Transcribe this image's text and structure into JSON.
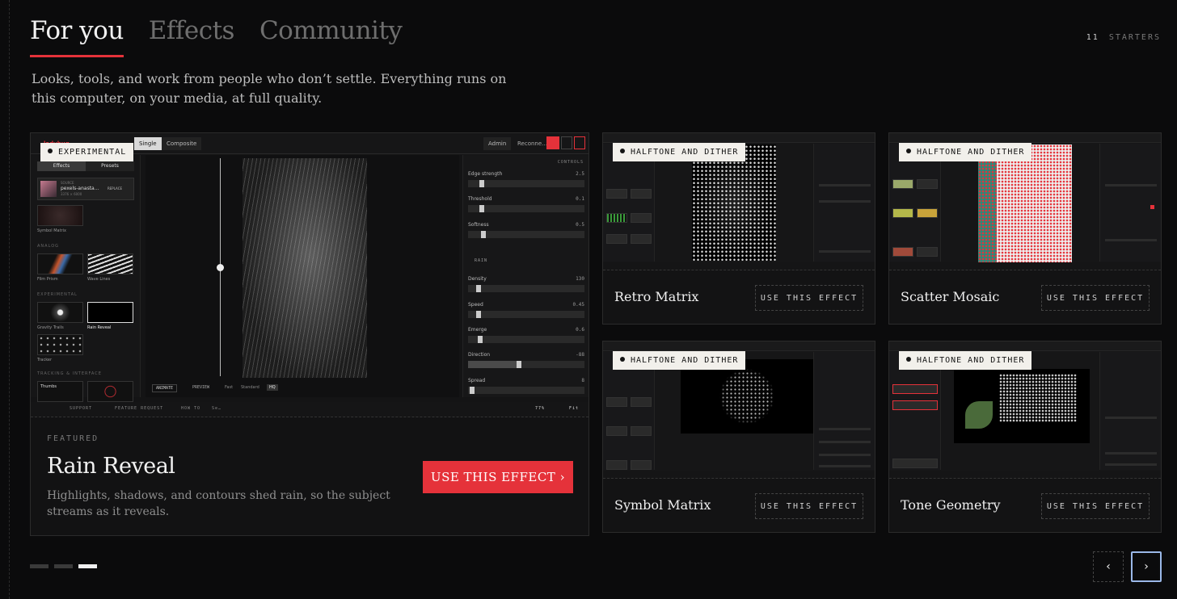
{
  "tabs": [
    "For you",
    "Effects",
    "Community"
  ],
  "starters": {
    "count": "11",
    "label": "STARTERS"
  },
  "intro": "Looks, tools, and work from people who don’t settle. Everything runs on this computer, on your media, at full quality.",
  "featured": {
    "badge": "EXPERIMENTAL",
    "kicker": "FEATURED",
    "title": "Rain Reveal",
    "description": "Highlights, shadows, and contours shed rain, so the subject streams as it reveals.",
    "cta": "USE THIS EFFECT ›",
    "app": {
      "logo": "ladybug",
      "modes": [
        "Single",
        "Composite"
      ],
      "user": "Admin",
      "status": "Reconne…",
      "left_tabs": [
        "Effects",
        "Presets"
      ],
      "source_label": "SOURCE",
      "source_name": "pexels-anasta…",
      "source_dims": "3376 × 6000",
      "replace": "REPLACE",
      "symbol_matrix": "Symbol Matrix",
      "section_analog": "ANALOG",
      "analog": [
        "Film Prism",
        "Wave Lines"
      ],
      "section_experimental": "EXPERIMENTAL",
      "experimental": [
        "Gravity Trails",
        "Rain Reveal"
      ],
      "tracker": "Tracker",
      "section_tracking": "TRACKING & INTERFACE",
      "thumbs": "Thumbs",
      "controls_title": "CONTROLS",
      "controls": [
        {
          "name": "Edge strength",
          "value": "2.5"
        },
        {
          "name": "Threshold",
          "value": "0.1"
        },
        {
          "name": "Softness",
          "value": "0.5"
        }
      ],
      "rain_section": "RAIN",
      "rain_controls": [
        {
          "name": "Density",
          "value": "130"
        },
        {
          "name": "Speed",
          "value": "0.45"
        },
        {
          "name": "Emerge",
          "value": "0.6"
        },
        {
          "name": "Direction",
          "value": "-88"
        },
        {
          "name": "Spread",
          "value": "8"
        }
      ],
      "animate": "ANIMATE",
      "preview": "PREVIEW",
      "quality": [
        "Fast",
        "Standard",
        "HQ"
      ],
      "bottom": [
        "SUPPORT",
        "FEATURE REQUEST",
        "HOW TO"
      ],
      "search_placeholder": "Se…",
      "zoom": "77%",
      "fit": "Fit"
    }
  },
  "cards": [
    {
      "title": "Retro Matrix",
      "badge": "HALFTONE AND DITHER",
      "cta": "USE THIS EFFECT"
    },
    {
      "title": "Scatter Mosaic",
      "badge": "HALFTONE AND DITHER",
      "cta": "USE THIS EFFECT"
    },
    {
      "title": "Symbol Matrix",
      "badge": "HALFTONE AND DITHER",
      "cta": "USE THIS EFFECT"
    },
    {
      "title": "Tone Geometry",
      "badge": "HALFTONE AND DITHER",
      "cta": "USE THIS EFFECT"
    }
  ],
  "pager": {
    "pages": 3,
    "current": 3
  },
  "nav": {
    "prev": "‹",
    "next": "›"
  },
  "colors": {
    "accent": "#e5323a",
    "bg": "#0b0b0c",
    "focus": "#9bb8e8"
  }
}
